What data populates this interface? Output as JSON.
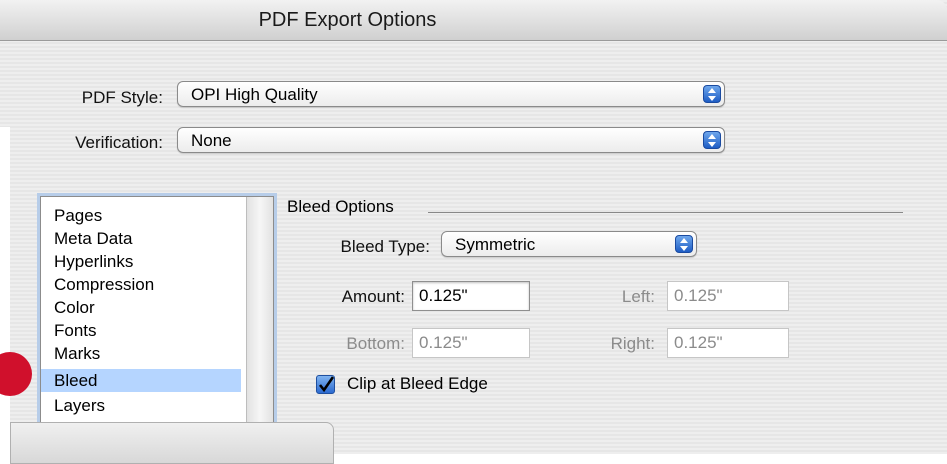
{
  "window": {
    "title": "PDF Export Options"
  },
  "pdf_style": {
    "label": "PDF Style:",
    "value": "OPI High Quality"
  },
  "verification": {
    "label": "Verification:",
    "value": "None"
  },
  "categories": [
    {
      "label": "Pages"
    },
    {
      "label": "Meta Data"
    },
    {
      "label": "Hyperlinks"
    },
    {
      "label": "Compression"
    },
    {
      "label": "Color"
    },
    {
      "label": "Fonts"
    },
    {
      "label": "Marks"
    },
    {
      "label": "Bleed",
      "selected": true
    },
    {
      "label": "Layers"
    }
  ],
  "bleed": {
    "section_title": "Bleed Options",
    "type_label": "Bleed Type:",
    "type_value": "Symmetric",
    "amount_label": "Amount:",
    "amount_value": "0.125\"",
    "left_label": "Left:",
    "left_value": "0.125\"",
    "bottom_label": "Bottom:",
    "bottom_value": "0.125\"",
    "right_label": "Right:",
    "right_value": "0.125\"",
    "clip_label": "Clip at Bleed Edge",
    "clip_checked": true
  },
  "colors": {
    "accent": "#1f5dc4",
    "selection": "#b5d5ff",
    "marker": "#d0102c"
  }
}
